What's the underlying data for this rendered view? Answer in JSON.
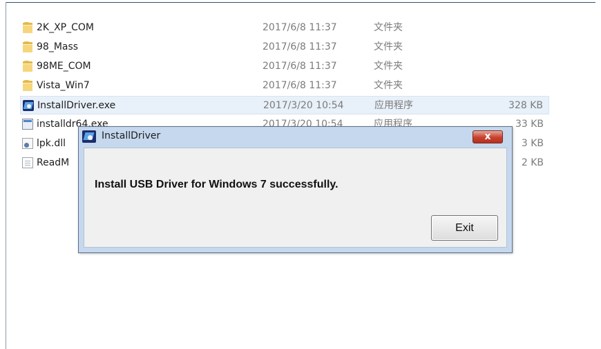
{
  "files": [
    {
      "name": "2K_XP_COM",
      "date": "2017/6/8 11:37",
      "type": "文件夹",
      "size": "",
      "icon": "folder-icon"
    },
    {
      "name": "98_Mass",
      "date": "2017/6/8 11:37",
      "type": "文件夹",
      "size": "",
      "icon": "folder-icon"
    },
    {
      "name": "98ME_COM",
      "date": "2017/6/8 11:37",
      "type": "文件夹",
      "size": "",
      "icon": "folder-icon"
    },
    {
      "name": "Vista_Win7",
      "date": "2017/6/8 11:37",
      "type": "文件夹",
      "size": "",
      "icon": "folder-icon"
    },
    {
      "name": "InstallDriver.exe",
      "date": "2017/3/20 10:54",
      "type": "应用程序",
      "size": "328 KB",
      "icon": "installdriver-app-icon"
    },
    {
      "name": "installdr64.exe",
      "date": "2017/3/20 10:54",
      "type": "应用程序",
      "size": "33 KB",
      "icon": "application-icon"
    },
    {
      "name": "lpk.dll",
      "date": "",
      "type": "",
      "size": "3 KB",
      "icon": "dll-icon"
    },
    {
      "name": "ReadM",
      "date": "",
      "type": "",
      "size": "2 KB",
      "icon": "text-file-icon"
    }
  ],
  "dialog": {
    "title": "InstallDriver",
    "close_label": "x",
    "message": "Install USB Driver for Windows 7 successfully.",
    "exit_label": "Exit"
  }
}
